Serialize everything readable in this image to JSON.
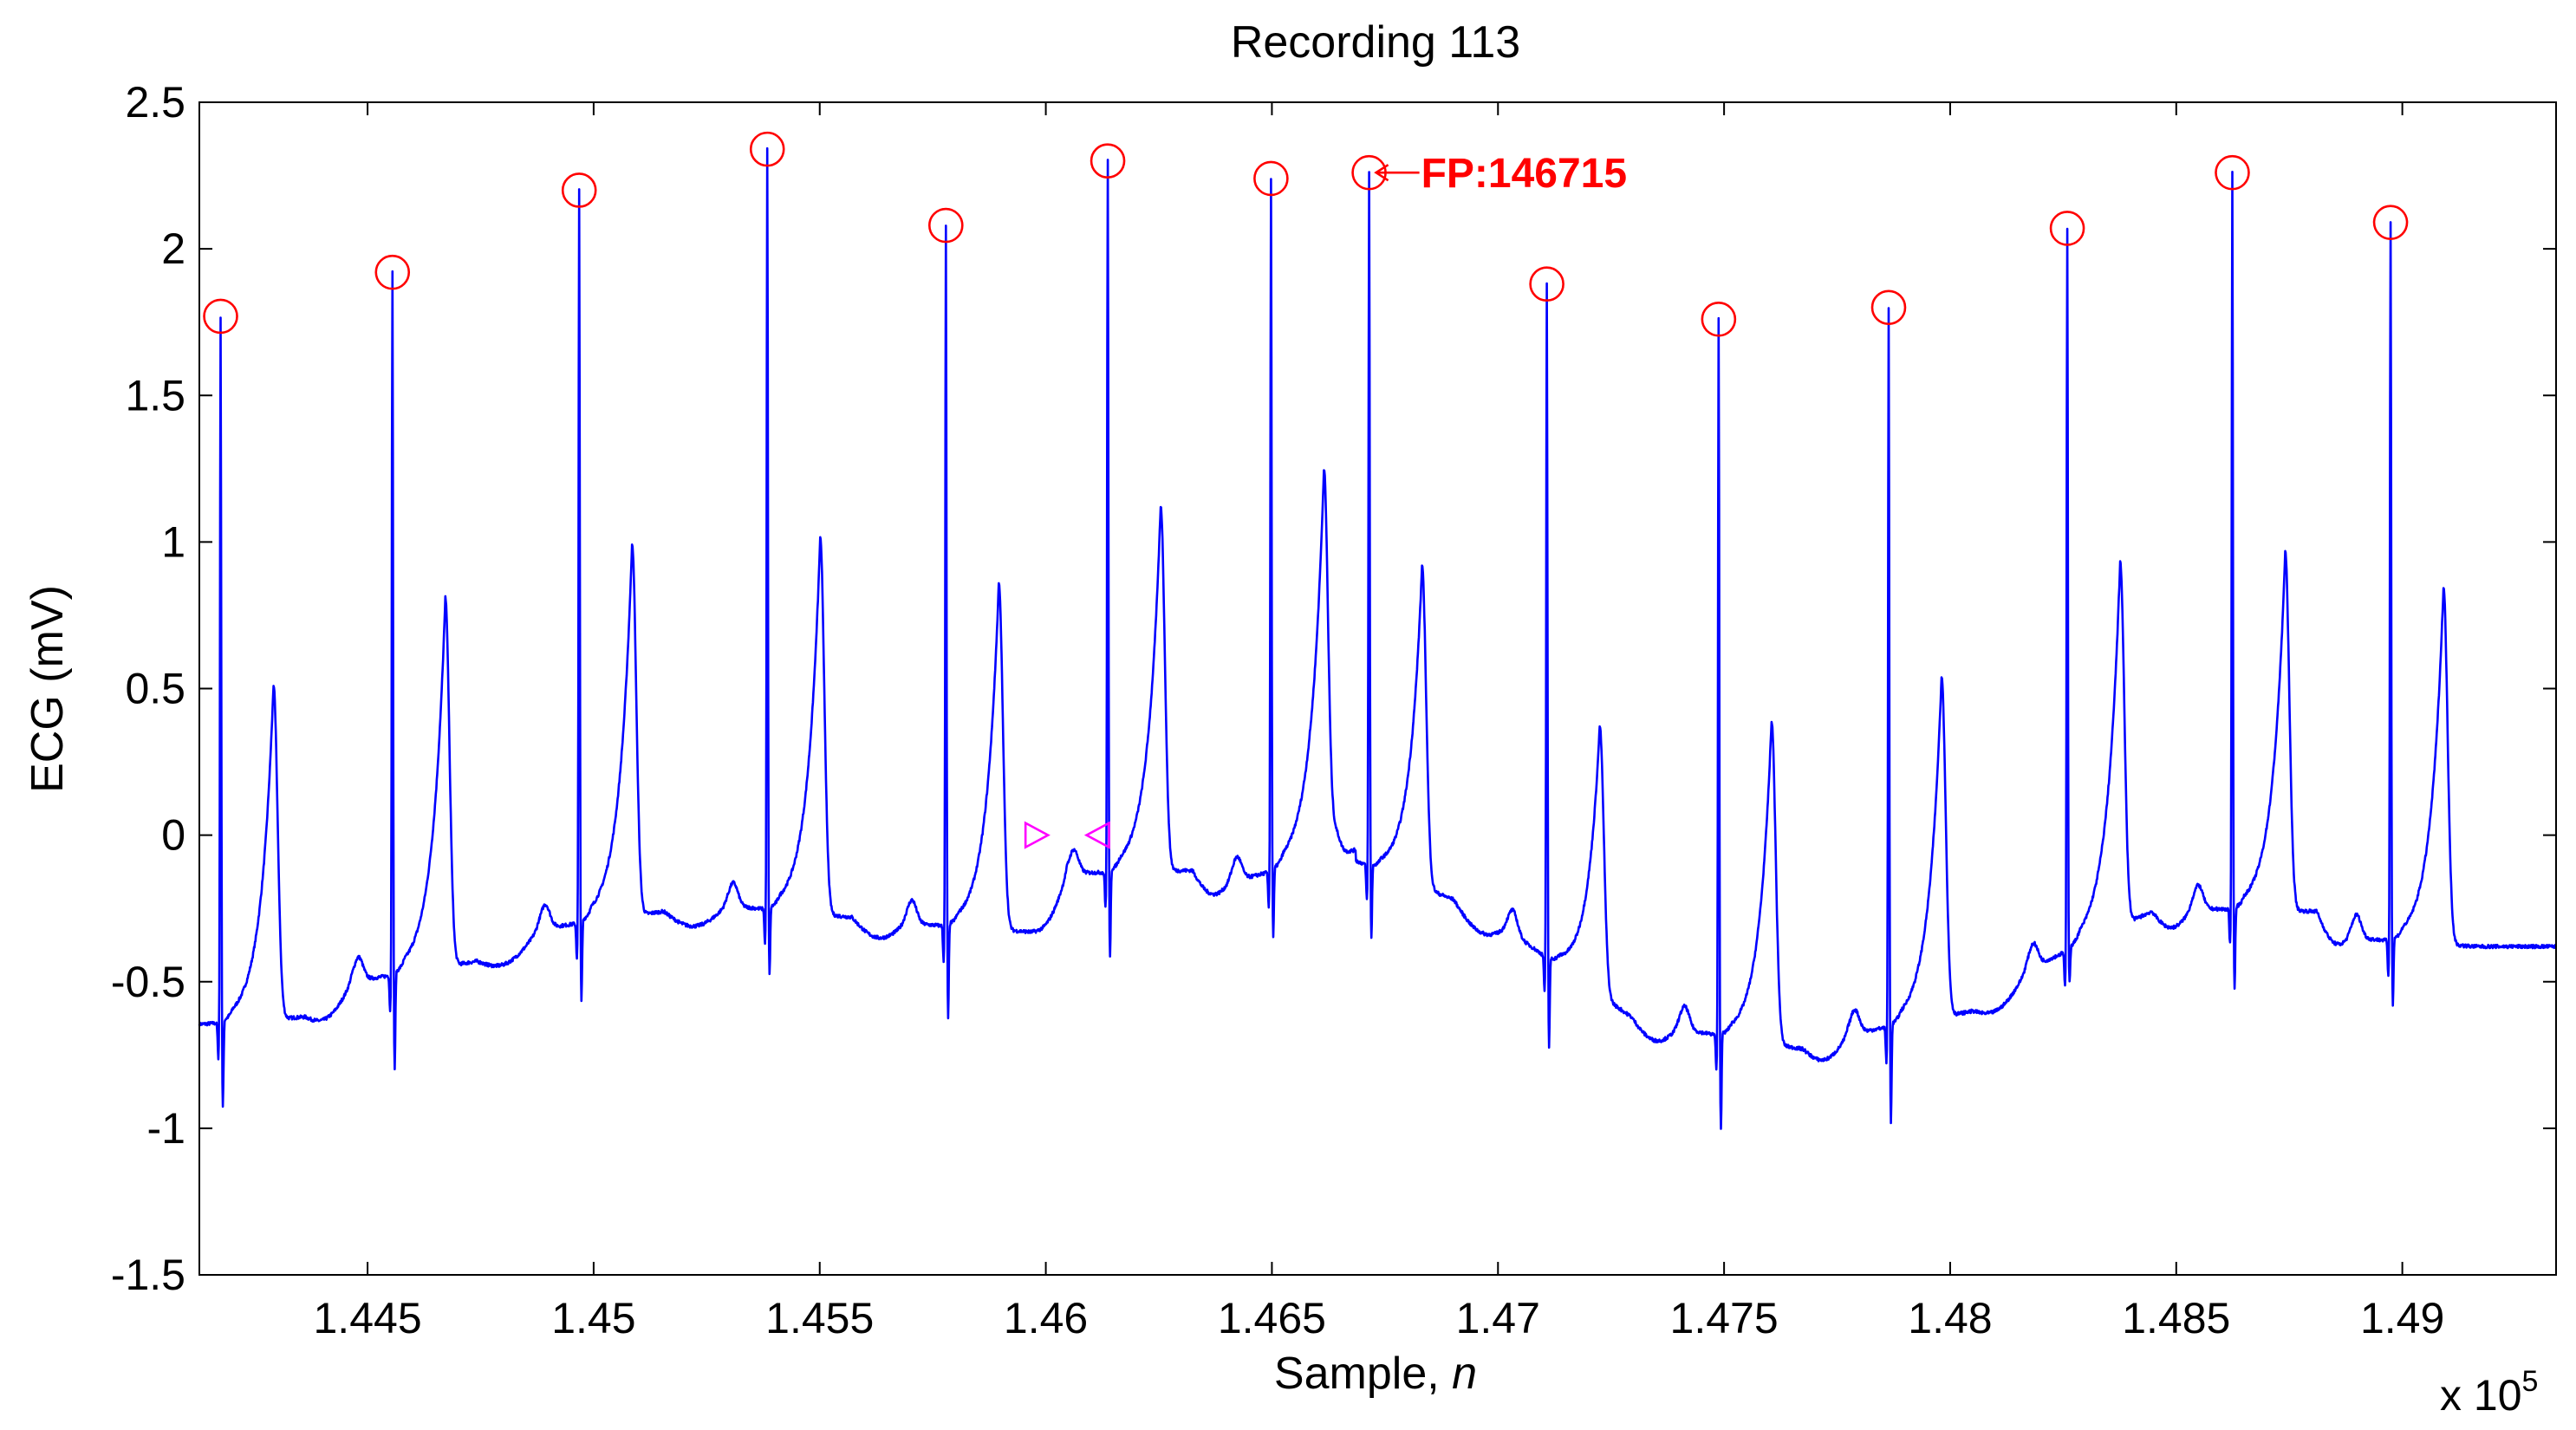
{
  "chart_data": {
    "type": "line",
    "title": "Recording 113",
    "xlabel": "Sample, ",
    "xlabel_italic": "n",
    "x_multiplier": "x 10",
    "x_multiplier_exp": "5",
    "ylabel": "ECG (mV)",
    "xlim": [
      144128,
      149340
    ],
    "ylim": [
      -1.5,
      2.5
    ],
    "grid": false,
    "x_ticks": [
      144500,
      145000,
      145500,
      146000,
      146500,
      147000,
      147500,
      148000,
      148500,
      149000
    ],
    "x_tick_labels": [
      "1.445",
      "1.45",
      "1.455",
      "1.46",
      "1.465",
      "1.47",
      "1.475",
      "1.48",
      "1.485",
      "1.49"
    ],
    "y_ticks": [
      -1.5,
      -1,
      -0.5,
      0,
      0.5,
      1,
      1.5,
      2,
      2.5
    ],
    "y_tick_labels": [
      "-1.5",
      "-1",
      "-0.5",
      "0",
      "0.5",
      "1",
      "1.5",
      "2",
      "2.5"
    ],
    "series": [
      {
        "name": "ECG",
        "color": "#0000ff",
        "beats": [
          {
            "r": 144175,
            "r_amp": 1.77,
            "s_amp": -0.93,
            "pre": -0.65,
            "post": -0.62,
            "t_amp": 0.5
          },
          {
            "r": 144555,
            "r_amp": 1.92,
            "s_amp": -0.8,
            "pre": -0.5,
            "post": -0.43,
            "t_amp": 0.78
          },
          {
            "r": 144968,
            "r_amp": 2.2,
            "s_amp": -0.57,
            "pre": -0.32,
            "post": -0.26,
            "t_amp": 0.97
          },
          {
            "r": 145384,
            "r_amp": 2.34,
            "s_amp": -0.47,
            "pre": -0.24,
            "post": -0.28,
            "t_amp": 1.03
          },
          {
            "r": 145779,
            "r_amp": 2.08,
            "s_amp": -0.63,
            "pre": -0.3,
            "post": -0.33,
            "t_amp": 0.87
          },
          {
            "r": 146137,
            "r_amp": 2.3,
            "s_amp": -0.42,
            "pre": -0.13,
            "post": -0.12,
            "t_amp": 1.12
          },
          {
            "r": 146498,
            "r_amp": 2.24,
            "s_amp": -0.35,
            "pre": -0.16,
            "post": -0.05,
            "t_amp": 1.2
          },
          {
            "r": 146715,
            "r_amp": 2.26,
            "s_amp": -0.35,
            "pre": -0.05,
            "post": -0.22,
            "t_amp": 0.99
          },
          {
            "r": 147108,
            "r_amp": 1.88,
            "s_amp": -0.72,
            "pre": -0.32,
            "post": -0.62,
            "t_amp": 0.5
          },
          {
            "r": 147488,
            "r_amp": 1.76,
            "s_amp": -1.0,
            "pre": -0.66,
            "post": -0.73,
            "t_amp": 0.42
          },
          {
            "r": 147864,
            "r_amp": 1.8,
            "s_amp": -0.98,
            "pre": -0.68,
            "post": -0.6,
            "t_amp": 0.51
          },
          {
            "r": 148259,
            "r_amp": 2.07,
            "s_amp": -0.5,
            "pre": -0.46,
            "post": -0.26,
            "t_amp": 0.85
          },
          {
            "r": 148624,
            "r_amp": 2.26,
            "s_amp": -0.53,
            "pre": -0.25,
            "post": -0.26,
            "t_amp": 0.97
          },
          {
            "r": 148974,
            "r_amp": 2.09,
            "s_amp": -0.58,
            "pre": -0.35,
            "post": -0.38,
            "t_amp": 0.86
          }
        ],
        "t_delay_samples": 117
      }
    ],
    "detected_peaks": {
      "color": "#ff0000",
      "marker": "circle",
      "points": [
        {
          "x": 144175,
          "y": 1.77
        },
        {
          "x": 144555,
          "y": 1.92
        },
        {
          "x": 144968,
          "y": 2.2
        },
        {
          "x": 145384,
          "y": 2.34
        },
        {
          "x": 145779,
          "y": 2.08
        },
        {
          "x": 146137,
          "y": 2.3
        },
        {
          "x": 146498,
          "y": 2.24
        },
        {
          "x": 146715,
          "y": 2.26
        },
        {
          "x": 147108,
          "y": 1.88
        },
        {
          "x": 147488,
          "y": 1.76
        },
        {
          "x": 147864,
          "y": 1.8
        },
        {
          "x": 148259,
          "y": 2.07
        },
        {
          "x": 148624,
          "y": 2.26
        },
        {
          "x": 148974,
          "y": 2.09
        }
      ]
    },
    "segment_markers": {
      "color": "#ff00ff",
      "points": [
        {
          "x": 145980,
          "y": 0,
          "dir": "right"
        },
        {
          "x": 146115,
          "y": 0,
          "dir": "left"
        }
      ]
    },
    "annotations": [
      {
        "text": "FP:146715",
        "x": 146715,
        "y": 2.26,
        "color": "#ff0000"
      }
    ]
  }
}
